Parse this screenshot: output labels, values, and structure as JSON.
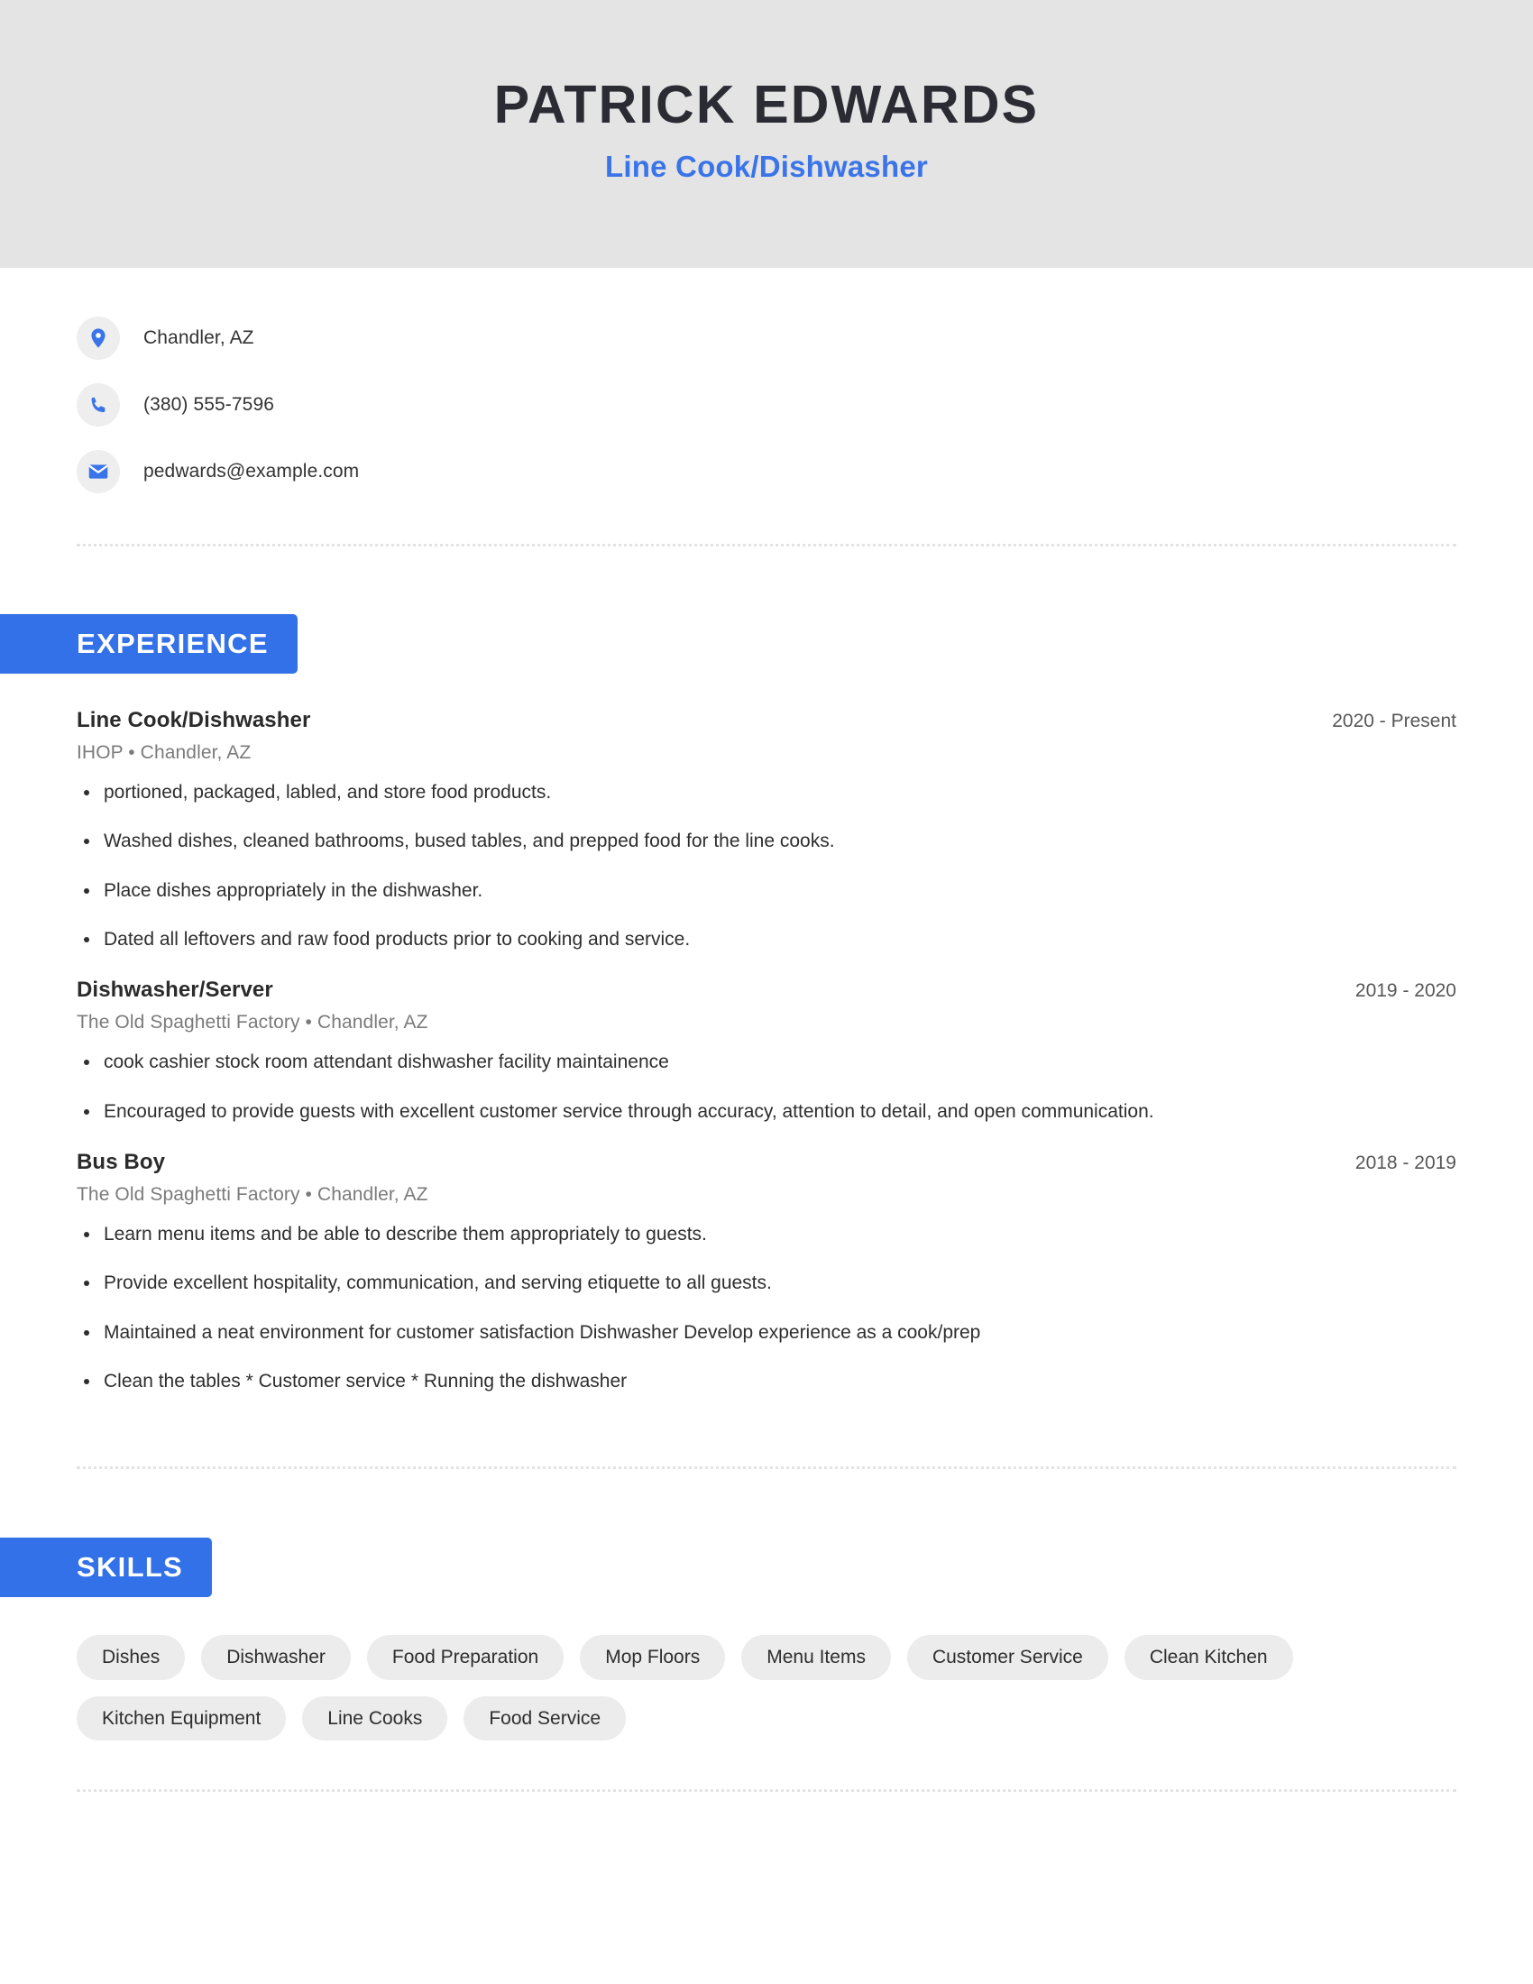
{
  "header": {
    "name": "PATRICK EDWARDS",
    "subtitle": "Line Cook/Dishwasher",
    "band_color": "#e4e4e4",
    "accent_color": "#3371e8"
  },
  "contact": {
    "items": [
      {
        "icon": "location-pin-icon",
        "text": "Chandler, AZ"
      },
      {
        "icon": "phone-icon",
        "text": "(380) 555-7596"
      },
      {
        "icon": "email-icon",
        "text": "pedwards@example.com"
      }
    ]
  },
  "experience": {
    "heading": "EXPERIENCE",
    "entries": [
      {
        "title": "Line Cook/Dishwasher",
        "dates": "2020 - Present",
        "meta": "IHOP  • Chandler, AZ",
        "bullets": [
          "portioned, packaged, labled, and store food products.",
          "Washed dishes, cleaned bathrooms, bused tables, and prepped food for the line cooks.",
          "Place dishes appropriately in the dishwasher.",
          "Dated all leftovers and raw food products prior to cooking and service."
        ]
      },
      {
        "title": "Dishwasher/Server",
        "dates": "2019 - 2020",
        "meta": "The Old Spaghetti Factory  • Chandler, AZ",
        "bullets": [
          "cook cashier stock room attendant dishwasher facility maintainence",
          "Encouraged to provide guests with excellent customer service through accuracy, attention to detail, and open communication."
        ]
      },
      {
        "title": "Bus Boy",
        "dates": "2018 - 2019",
        "meta": "The Old Spaghetti Factory  • Chandler, AZ",
        "bullets": [
          "Learn menu items and be able to describe them appropriately to guests.",
          "Provide excellent hospitality, communication, and serving etiquette to all guests.",
          "Maintained a neat environment for customer satisfaction Dishwasher Develop experience as a cook/prep",
          "Clean the tables * Customer service * Running the dishwasher"
        ]
      }
    ]
  },
  "skills": {
    "heading": "SKILLS",
    "items": [
      "Dishes",
      "Dishwasher",
      "Food Preparation",
      "Mop Floors",
      "Menu Items",
      "Customer Service",
      "Clean Kitchen",
      "Kitchen Equipment",
      "Line Cooks",
      "Food Service"
    ]
  }
}
